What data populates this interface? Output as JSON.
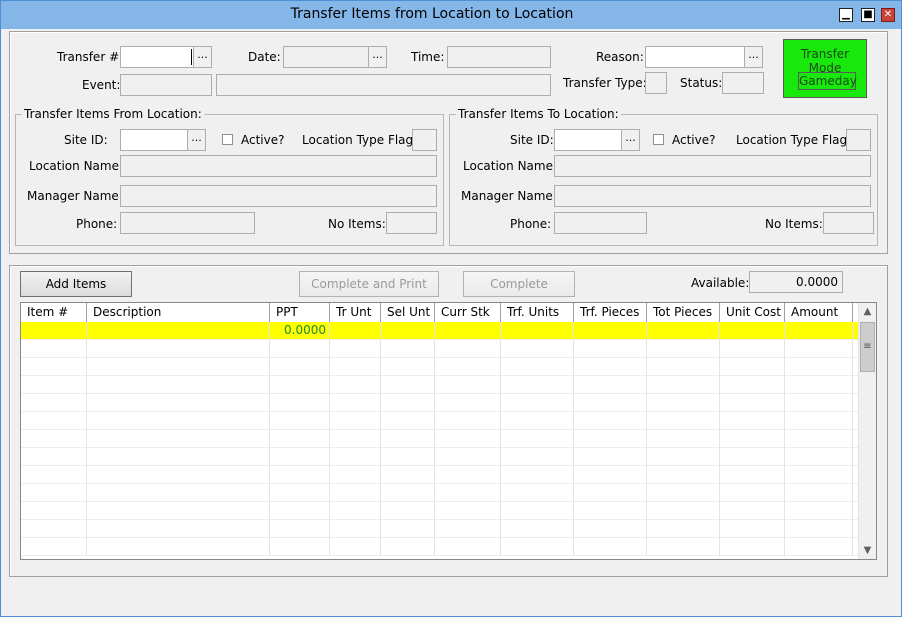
{
  "window": {
    "title": "Transfer Items from Location to Location"
  },
  "header": {
    "transfer_no_label": "Transfer #:",
    "transfer_no_value": "",
    "date_label": "Date:",
    "date_value": "",
    "time_label": "Time:",
    "time_value": "",
    "reason_label": "Reason:",
    "reason_value": "",
    "event_label": "Event:",
    "event_code": "",
    "event_desc": "",
    "transfer_type_label": "Transfer Type:",
    "transfer_type_value": "",
    "status_label": "Status:",
    "status_value": "",
    "ellipsis": "...",
    "transfer_mode_label": "Transfer Mode",
    "transfer_mode_value": "Gameday",
    "transfer_mode_color": "#18e80c"
  },
  "from": {
    "title": "Transfer Items From Location:",
    "site_id_label": "Site ID:",
    "active_label": "Active?",
    "loc_type_flag_label": "Location Type Flag:",
    "location_name_label": "Location Name:",
    "manager_name_label": "Manager Name:",
    "phone_label": "Phone:",
    "no_items_label": "No Items:"
  },
  "to": {
    "title": "Transfer Items To Location:",
    "site_id_label": "Site ID:",
    "active_label": "Active?",
    "loc_type_flag_label": "Location Type Flag:",
    "location_name_label": "Location Name:",
    "manager_name_label": "Manager Name:",
    "phone_label": "Phone:",
    "no_items_label": "No Items:"
  },
  "actions": {
    "add_items": "Add Items",
    "complete_print": "Complete and Print",
    "complete": "Complete",
    "available_label": "Available:",
    "available_value": "0.0000"
  },
  "grid": {
    "columns": [
      "Item #",
      "Description",
      "PPT",
      "Tr Unt",
      "Sel Unt",
      "Curr Stk",
      "Trf. Units",
      "Trf. Pieces",
      "Tot Pieces",
      "Unit Cost",
      "Amount"
    ],
    "rows": [
      {
        "ppt": "0.0000"
      }
    ],
    "highlight_color": "#ffff00"
  }
}
